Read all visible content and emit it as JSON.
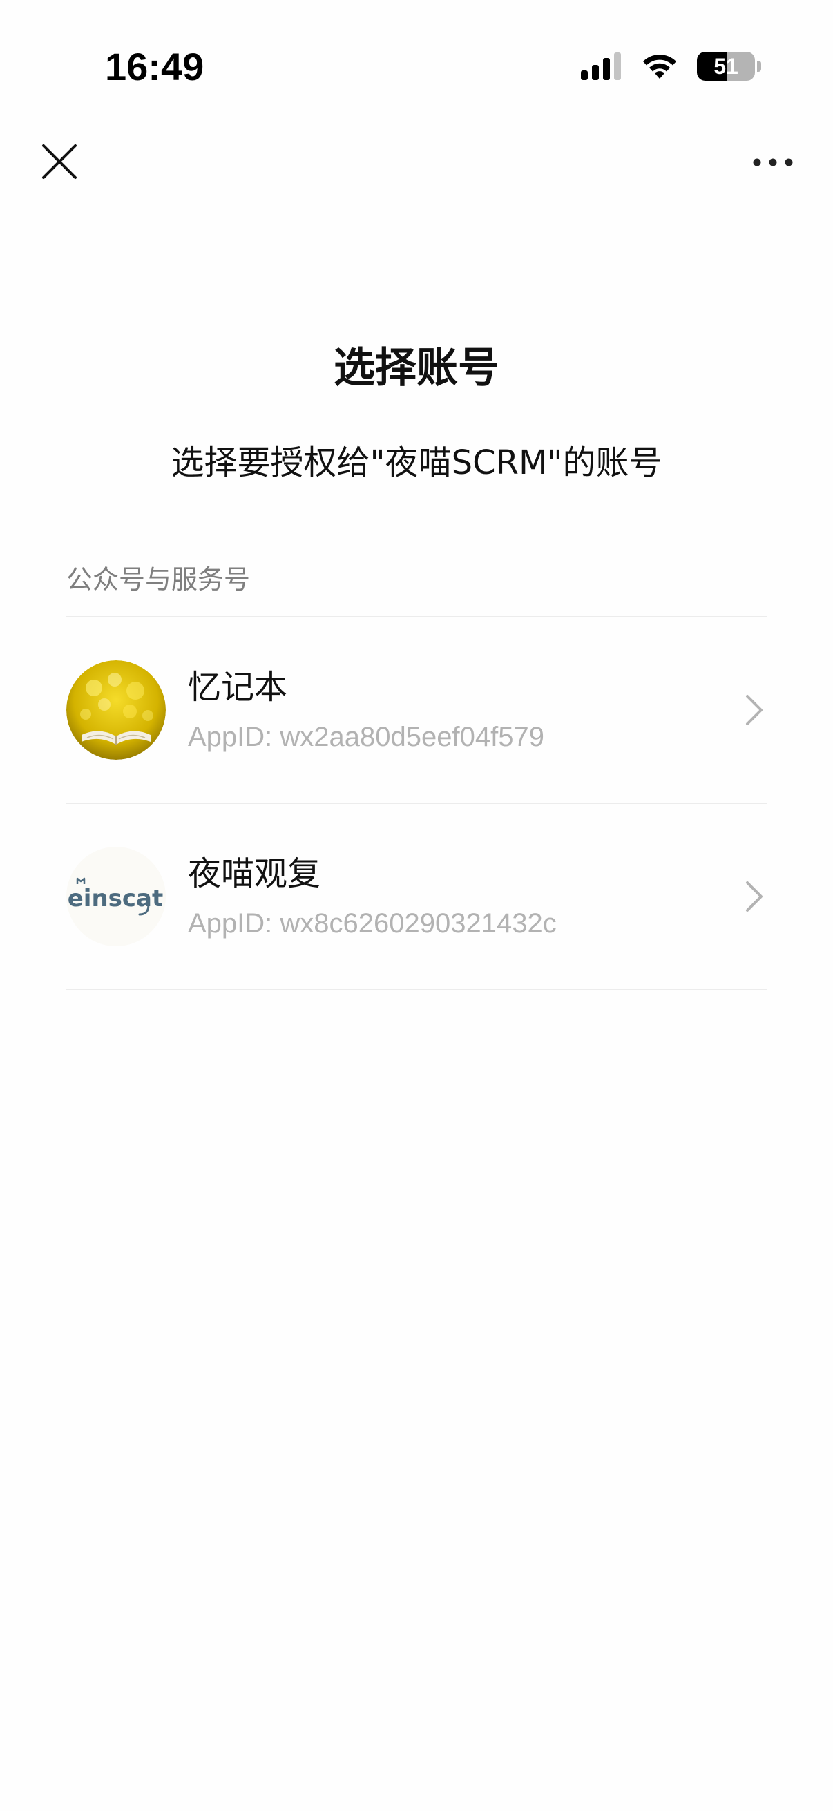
{
  "status_bar": {
    "time": "16:49",
    "battery_level": "51",
    "battery_fraction": 0.51,
    "icons": [
      "signal-icon",
      "wifi-icon",
      "battery-icon"
    ]
  },
  "nav": {
    "close_icon": "close-icon",
    "more_icon": "more-horizontal-icon"
  },
  "header": {
    "title": "选择账号",
    "subtitle": "选择要授权给\"夜喵SCRM\"的账号"
  },
  "section": {
    "label": "公众号与服务号"
  },
  "accounts": [
    {
      "name": "忆记本",
      "appid": "AppID: wx2aa80d5eef04f579",
      "avatar_icon": "book-bokeh-avatar"
    },
    {
      "name": "夜喵观复",
      "appid": "AppID: wx8c6260290321432c",
      "avatar_icon": "einscat-logo-avatar",
      "avatar_text": "einscat"
    }
  ],
  "colors": {
    "text_primary": "#111111",
    "text_secondary": "#7f7f7f",
    "text_tertiary": "#b2b2b2",
    "divider": "#ececec",
    "avatar_yellow": "#e6c500",
    "logo_blue": "#4d6b7f"
  }
}
